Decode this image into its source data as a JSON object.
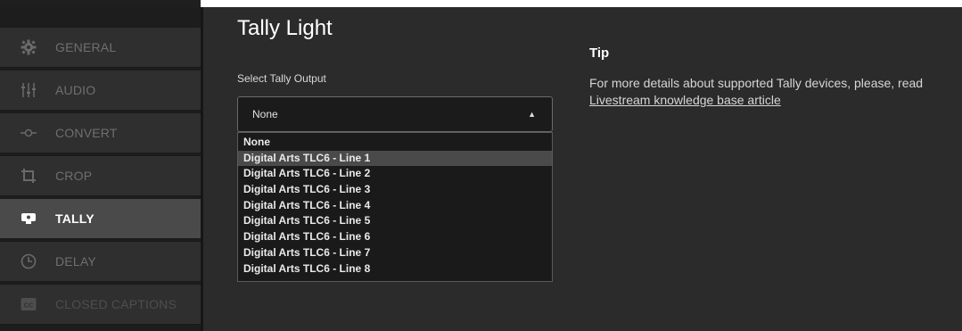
{
  "sidebar": {
    "items": [
      {
        "label": "GENERAL",
        "icon": "gear-icon"
      },
      {
        "label": "AUDIO",
        "icon": "audio-sliders-icon"
      },
      {
        "label": "CONVERT",
        "icon": "convert-icon"
      },
      {
        "label": "CROP",
        "icon": "crop-icon"
      },
      {
        "label": "TALLY",
        "icon": "tally-icon",
        "active": true
      },
      {
        "label": "DELAY",
        "icon": "clock-icon"
      },
      {
        "label": "CLOSED CAPTIONS",
        "icon": "cc-icon"
      }
    ]
  },
  "main": {
    "title": "Tally Light",
    "select_label": "Select Tally Output",
    "select_value": "None",
    "options": [
      "None",
      "Digital Arts TLC6 - Line 1",
      "Digital Arts TLC6 - Line 2",
      "Digital Arts TLC6 - Line 3",
      "Digital Arts TLC6 - Line 4",
      "Digital Arts TLC6 - Line 5",
      "Digital Arts TLC6 - Line 6",
      "Digital Arts TLC6 - Line 7",
      "Digital Arts TLC6 - Line 8"
    ],
    "hovered_option": 1
  },
  "tip": {
    "title": "Tip",
    "text": "For more details about supported Tally devices, please, read ",
    "link": "Livestream knowledge base article"
  },
  "colors": {
    "background": "#2b2b2b",
    "sidebar": "#1d1d1d",
    "active_item": "#4a4a4a"
  }
}
